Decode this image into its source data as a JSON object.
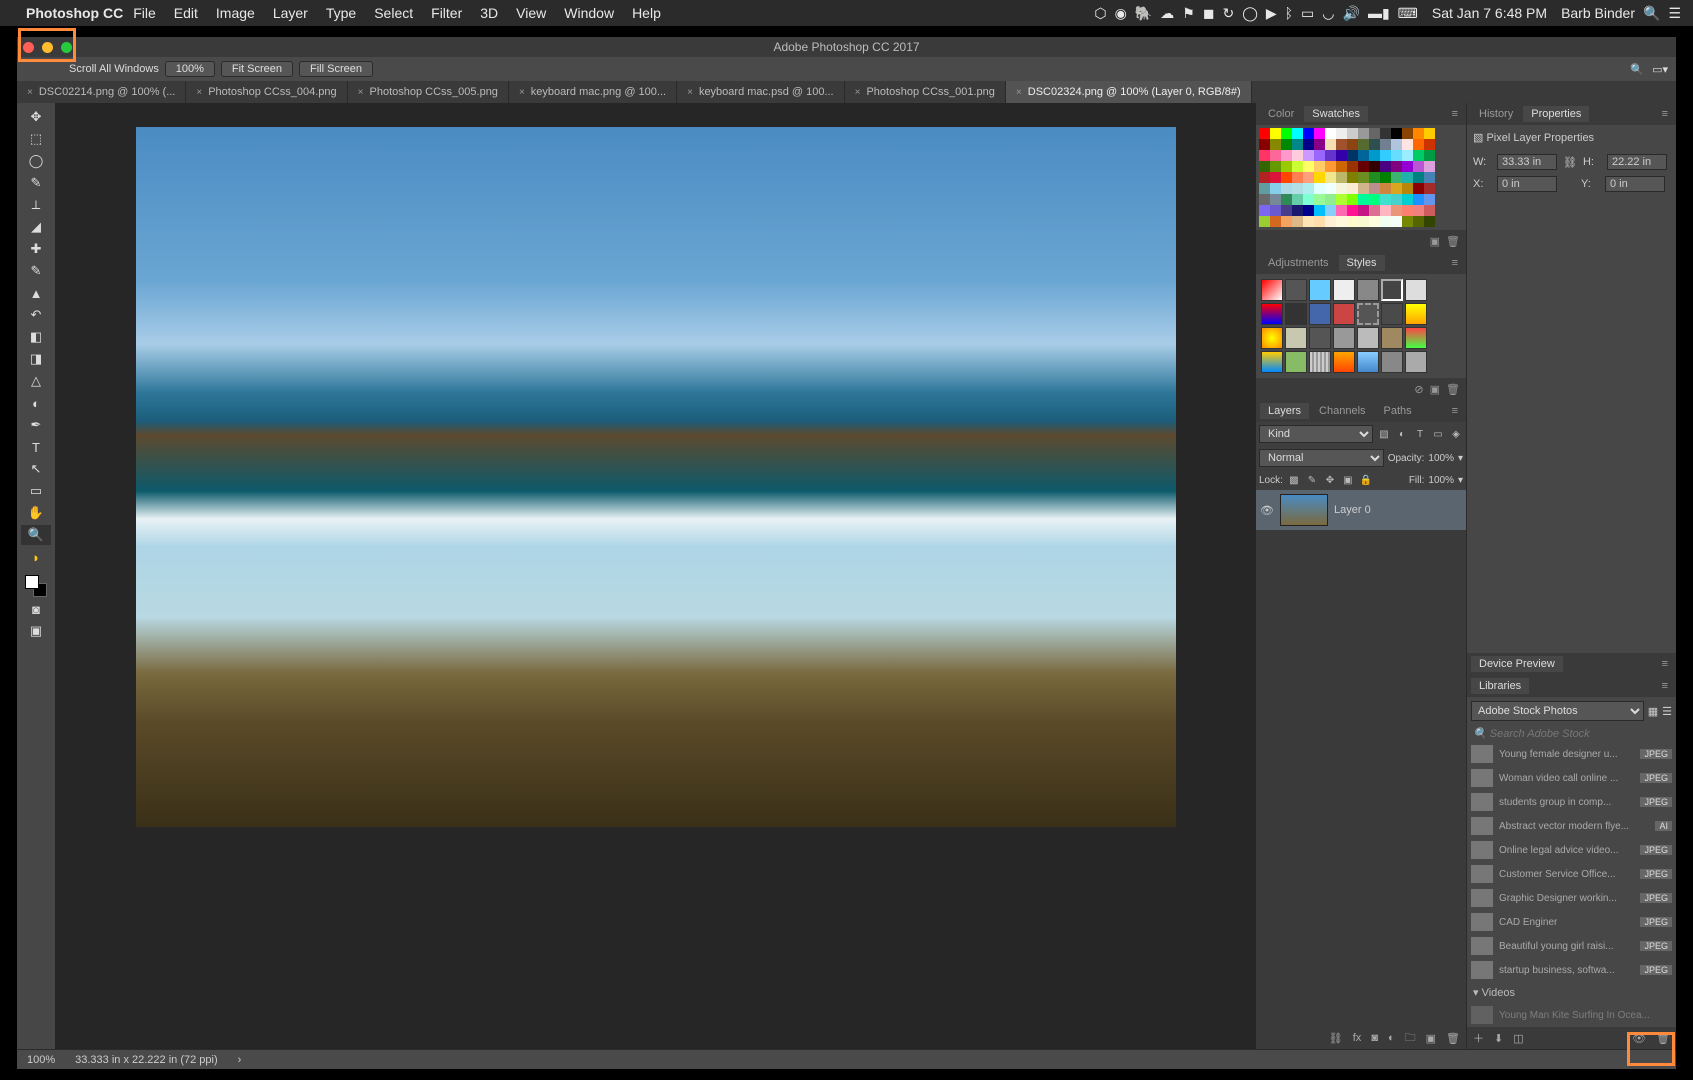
{
  "menubar": {
    "app": "Photoshop CC",
    "items": [
      "File",
      "Edit",
      "Image",
      "Layer",
      "Type",
      "Select",
      "Filter",
      "3D",
      "View",
      "Window",
      "Help"
    ],
    "datetime": "Sat Jan 7  6:48 PM",
    "user": "Barb Binder"
  },
  "window": {
    "title": "Adobe Photoshop CC 2017"
  },
  "options": {
    "scroll_label": "Scroll All Windows",
    "zoom": "100%",
    "fit": "Fit Screen",
    "fill": "Fill Screen"
  },
  "tabs": [
    {
      "label": "DSC02214.png @ 100% (...",
      "active": false
    },
    {
      "label": "Photoshop CCss_004.png",
      "active": false
    },
    {
      "label": "Photoshop CCss_005.png",
      "active": false
    },
    {
      "label": "keyboard mac.png @ 100...",
      "active": false
    },
    {
      "label": "keyboard mac.psd @ 100...",
      "active": false
    },
    {
      "label": "Photoshop CCss_001.png",
      "active": false
    },
    {
      "label": "DSC02324.png @ 100% (Layer 0, RGB/8#)",
      "active": true
    }
  ],
  "panels": {
    "color_tab": "Color",
    "swatches_tab": "Swatches",
    "adjustments_tab": "Adjustments",
    "styles_tab": "Styles",
    "layers_tab": "Layers",
    "channels_tab": "Channels",
    "paths_tab": "Paths",
    "history_tab": "History",
    "properties_tab": "Properties",
    "device_preview": "Device Preview",
    "libraries": "Libraries"
  },
  "swatch_colors": [
    "#ff0000",
    "#ffff00",
    "#00ff00",
    "#00ffff",
    "#0000ff",
    "#ff00ff",
    "#ffffff",
    "#eeeeee",
    "#cccccc",
    "#999999",
    "#666666",
    "#333333",
    "#000000",
    "#884400",
    "#ff8800",
    "#ffcc00",
    "#880000",
    "#888800",
    "#008800",
    "#008888",
    "#000088",
    "#880088",
    "#f5deb3",
    "#a0522d",
    "#8b4513",
    "#556b2f",
    "#2f4f4f",
    "#708090",
    "#b0c4de",
    "#ffe4e1",
    "#ff6600",
    "#cc3300",
    "#ff3366",
    "#ff6699",
    "#ff99cc",
    "#ffccdd",
    "#cc99ff",
    "#9966ff",
    "#6633cc",
    "#3300aa",
    "#003366",
    "#006699",
    "#0099cc",
    "#33ccff",
    "#66ddff",
    "#99eeff",
    "#00cc66",
    "#009944",
    "#336600",
    "#669900",
    "#99cc00",
    "#ccff33",
    "#ffff66",
    "#ffcc66",
    "#ff9933",
    "#cc6600",
    "#993300",
    "#660000",
    "#330000",
    "#4b0082",
    "#800080",
    "#9400d3",
    "#ba55d3",
    "#dda0dd",
    "#b22222",
    "#dc143c",
    "#ff4500",
    "#ff7f50",
    "#ffa07a",
    "#ffd700",
    "#f0e68c",
    "#bdb76b",
    "#808000",
    "#6b8e23",
    "#228b22",
    "#008000",
    "#3cb371",
    "#20b2aa",
    "#008080",
    "#4682b4",
    "#5f9ea0",
    "#87ceeb",
    "#add8e6",
    "#b0e0e6",
    "#afeeee",
    "#e0ffff",
    "#f0ffff",
    "#f5f5dc",
    "#faebd7",
    "#d2b48c",
    "#bc8f8f",
    "#cd853f",
    "#daa520",
    "#b8860b",
    "#8b0000",
    "#a52a2a",
    "#696969",
    "#778899",
    "#2e8b57",
    "#66cdaa",
    "#7fffd4",
    "#98fb98",
    "#90ee90",
    "#adff2f",
    "#7fff00",
    "#00fa9a",
    "#00ff7f",
    "#40e0d0",
    "#48d1cc",
    "#00ced1",
    "#1e90ff",
    "#6495ed",
    "#7b68ee",
    "#6a5acd",
    "#483d8b",
    "#191970",
    "#00008b",
    "#00bfff",
    "#87cefa",
    "#ff69b4",
    "#ff1493",
    "#c71585",
    "#db7093",
    "#ffb6c1",
    "#e9967a",
    "#fa8072",
    "#f08080",
    "#cd5c5c",
    "#9acd32",
    "#d2691e",
    "#f4a460",
    "#deb887",
    "#ffe4b5",
    "#ffdead",
    "#ffefd5",
    "#fff8dc",
    "#fffacd",
    "#fafad2",
    "#ffffe0",
    "#f0fff0",
    "#f5fffa",
    "#778800",
    "#556600",
    "#334400"
  ],
  "layers": {
    "kind": "Kind",
    "blend": "Normal",
    "opacity_label": "Opacity:",
    "opacity": "100%",
    "lock_label": "Lock:",
    "fill_label": "Fill:",
    "fill": "100%",
    "layer0": "Layer 0"
  },
  "properties": {
    "title": "Pixel Layer Properties",
    "w_label": "W:",
    "w": "33.33 in",
    "h_label": "H:",
    "h": "22.22 in",
    "x_label": "X:",
    "x": "0 in",
    "y_label": "Y:",
    "y": "0 in"
  },
  "libraries": {
    "dropdown": "Adobe Stock Photos",
    "search_placeholder": "Search Adobe Stock",
    "items": [
      {
        "name": "Young female designer u...",
        "fmt": "JPEG"
      },
      {
        "name": "Woman video call online ...",
        "fmt": "JPEG"
      },
      {
        "name": "students group in comp...",
        "fmt": "JPEG"
      },
      {
        "name": "Abstract vector modern flye...",
        "fmt": "AI"
      },
      {
        "name": "Online legal advice video...",
        "fmt": "JPEG"
      },
      {
        "name": "Customer Service Office...",
        "fmt": "JPEG"
      },
      {
        "name": "Graphic Designer workin...",
        "fmt": "JPEG"
      },
      {
        "name": "CAD Enginer",
        "fmt": "JPEG"
      },
      {
        "name": "Beautiful young girl raisi...",
        "fmt": "JPEG"
      },
      {
        "name": "startup business, softwa...",
        "fmt": "JPEG"
      }
    ],
    "videos_section": "Videos",
    "video_item": "Young Man Kite Surfing In Ocea..."
  },
  "status": {
    "zoom": "100%",
    "doc": "33.333 in x 22.222 in (72 ppi)"
  }
}
